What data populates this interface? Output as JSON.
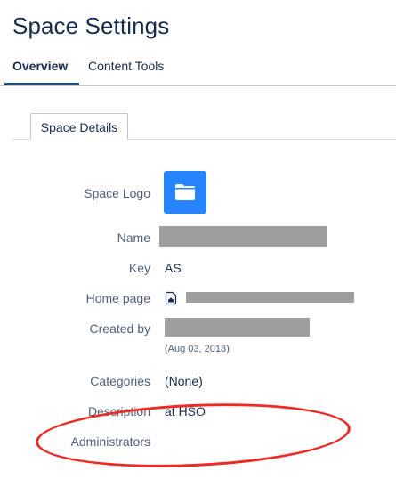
{
  "page": {
    "title": "Space Settings"
  },
  "tabs": [
    {
      "label": "Overview",
      "active": true
    },
    {
      "label": "Content Tools",
      "active": false
    }
  ],
  "subtab": {
    "label": "Space Details"
  },
  "details": {
    "logo_label": "Space Logo",
    "name_label": "Name",
    "key_label": "Key",
    "key_value": "AS",
    "homepage_label": "Home page",
    "created_label": "Created by",
    "created_date": "(Aug 03, 2018)",
    "categories_label": "Categories",
    "categories_value": "(None)",
    "description_label": "Description",
    "description_value": "at HSO",
    "administrators_label": "Administrators"
  },
  "icons": {
    "logo": "folder-icon",
    "homepage": "home-page-icon"
  },
  "colors": {
    "accent": "#205081",
    "logo_bg": "#2684ff",
    "annotation": "#ee2a24",
    "redaction": "#9e9e9e"
  }
}
